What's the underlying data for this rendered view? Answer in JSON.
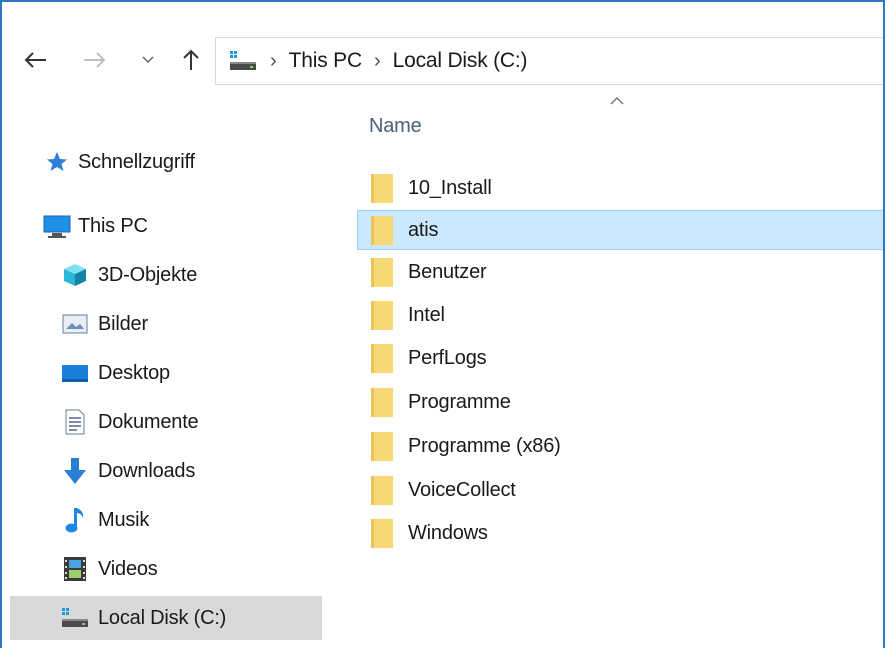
{
  "breadcrumb": [
    "This PC",
    "Local Disk (C:)"
  ],
  "column_header": "Name",
  "nav_items": [
    {
      "label": "Schnellzugriff",
      "icon": "star-icon"
    },
    {
      "label": "This PC",
      "icon": "computer-icon"
    },
    {
      "label": "3D-Objekte",
      "icon": "cube-icon"
    },
    {
      "label": "Bilder",
      "icon": "pictures-icon"
    },
    {
      "label": "Desktop",
      "icon": "desktop-icon"
    },
    {
      "label": "Dokumente",
      "icon": "document-icon"
    },
    {
      "label": "Downloads",
      "icon": "download-arrow-icon"
    },
    {
      "label": "Musik",
      "icon": "music-note-icon"
    },
    {
      "label": "Videos",
      "icon": "film-icon"
    },
    {
      "label": "Local Disk (C:)",
      "icon": "drive-icon"
    }
  ],
  "files": [
    {
      "name": "10_Install"
    },
    {
      "name": "atis"
    },
    {
      "name": "Benutzer"
    },
    {
      "name": "Intel"
    },
    {
      "name": "PerfLogs"
    },
    {
      "name": "Programme"
    },
    {
      "name": "Programme (x86)"
    },
    {
      "name": "VoiceCollect"
    },
    {
      "name": "Windows"
    }
  ],
  "selected_file": "atis",
  "selected_nav": "Local Disk (C:)",
  "colors": {
    "accent_border": "#2b79c2",
    "selection_fill": "#cce8ff",
    "selection_border": "#99d1ff",
    "nav_selected": "#d9d9d9",
    "folder": "#f8d775"
  }
}
